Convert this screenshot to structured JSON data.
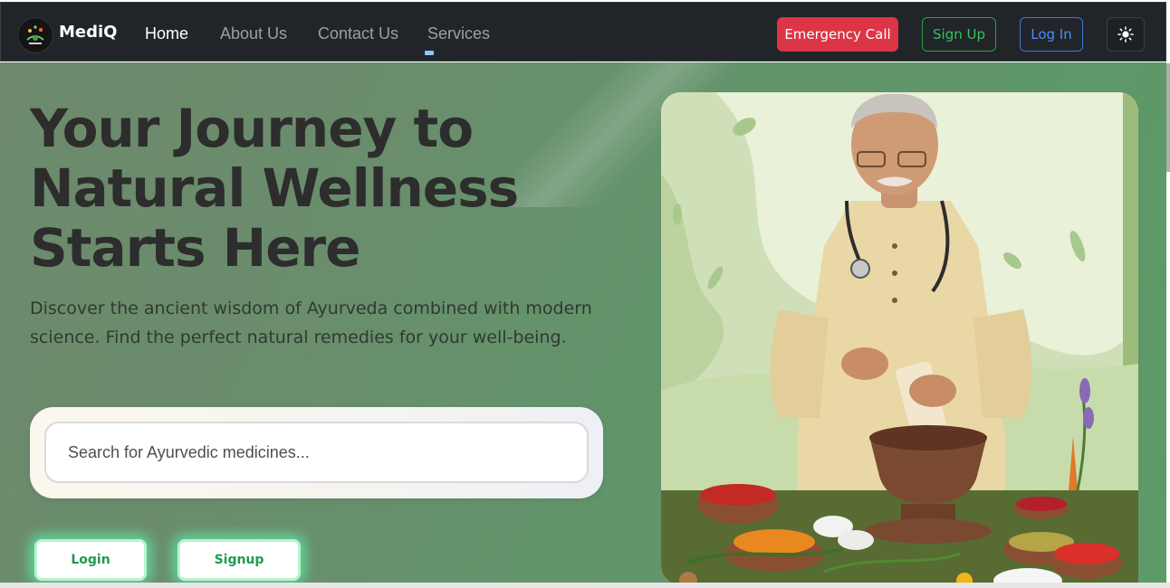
{
  "nav": {
    "brand": "MediQ",
    "links": [
      "Home",
      "About Us",
      "Contact Us",
      "Services"
    ],
    "emergency_label": "Emergency Call",
    "signup_label": "Sign Up",
    "login_label": "Log In",
    "theme_icon": "sun-icon"
  },
  "hero": {
    "title": "Your Journey to Natural Wellness Starts Here",
    "subtitle": "Discover the ancient wisdom of Ayurveda combined with modern science. Find the perfect natural remedies for your well-being.",
    "search_placeholder": "Search for Ayurvedic medicines...",
    "login_button": "Login",
    "signup_button": "Signup"
  },
  "colors": {
    "navbar": "#212529",
    "emergency": "#dc3545",
    "signup": "#2e9e4b",
    "login": "#3a78d8",
    "hero_green": "#6a8d6c"
  }
}
